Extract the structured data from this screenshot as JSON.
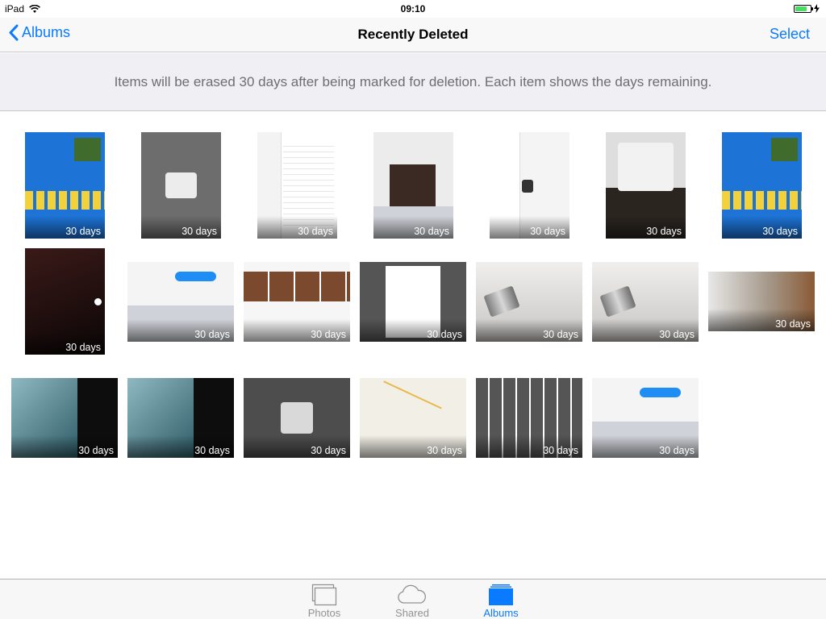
{
  "status_bar": {
    "device": "iPad",
    "time": "09:10",
    "battery_level": 0.8,
    "battery_color": "#4cd964"
  },
  "nav": {
    "back_label": "Albums",
    "title": "Recently Deleted",
    "action_label": "Select"
  },
  "info": {
    "text": "Items will be erased 30 days after being marked for deletion. Each item shows the days remaining."
  },
  "accent_color": "#0a7aff",
  "photos": [
    {
      "days_label": "30 days",
      "kind": "weather-app"
    },
    {
      "days_label": "30 days",
      "kind": "home-screen-alert"
    },
    {
      "days_label": "30 days",
      "kind": "settings-screen"
    },
    {
      "days_label": "30 days",
      "kind": "messages-photo"
    },
    {
      "days_label": "30 days",
      "kind": "settings-icloud"
    },
    {
      "days_label": "30 days",
      "kind": "share-sheet-crowd"
    },
    {
      "days_label": "30 days",
      "kind": "weather-app"
    },
    {
      "days_label": "30 days",
      "kind": "dark-photo"
    },
    {
      "days_label": "30 days",
      "kind": "messages-keyboard"
    },
    {
      "days_label": "30 days",
      "kind": "photos-share"
    },
    {
      "days_label": "30 days",
      "kind": "share-activity"
    },
    {
      "days_label": "30 days",
      "kind": "tin-can-lamp"
    },
    {
      "days_label": "30 days",
      "kind": "tin-can-lamp"
    },
    {
      "days_label": "30 days",
      "kind": "blur"
    },
    {
      "days_label": "30 days",
      "kind": "bridge-cables"
    },
    {
      "days_label": "30 days",
      "kind": "bridge-cables"
    },
    {
      "days_label": "30 days",
      "kind": "home-screen-alert-dark"
    },
    {
      "days_label": "30 days",
      "kind": "map"
    },
    {
      "days_label": "30 days",
      "kind": "photo-grid"
    },
    {
      "days_label": "30 days",
      "kind": "messages-keyboard"
    }
  ],
  "tabs": [
    {
      "label": "Photos",
      "icon": "photos-icon",
      "active": false
    },
    {
      "label": "Shared",
      "icon": "cloud-icon",
      "active": false
    },
    {
      "label": "Albums",
      "icon": "albums-icon",
      "active": true
    }
  ]
}
